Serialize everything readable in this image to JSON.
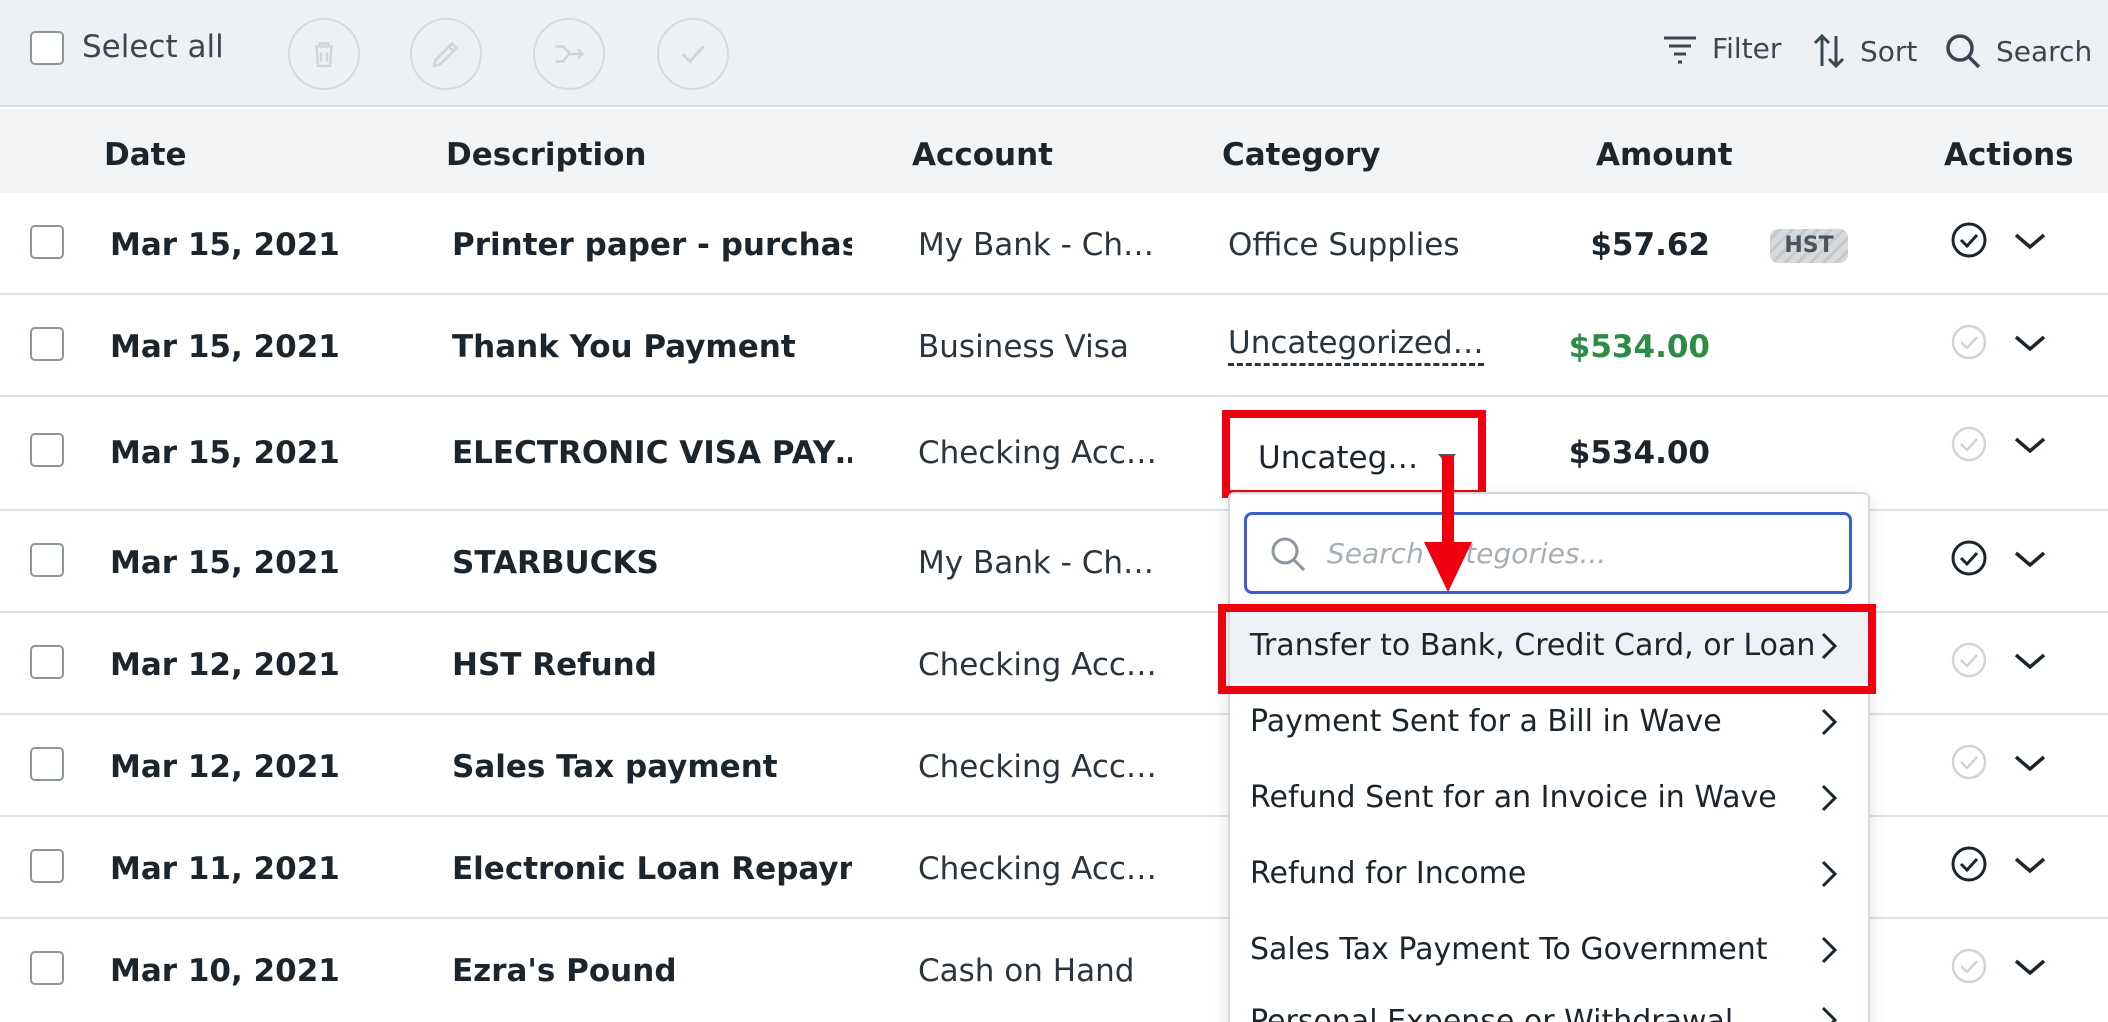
{
  "toolbar": {
    "select_all": "Select all",
    "filter": "Filter",
    "sort": "Sort",
    "search": "Search"
  },
  "columns": {
    "date": "Date",
    "description": "Description",
    "account": "Account",
    "category": "Category",
    "amount": "Amount",
    "actions": "Actions"
  },
  "rows": [
    {
      "date": "Mar 15, 2021",
      "description": "Printer paper - purchase…",
      "account": "My Bank - Ch…",
      "category": "Office Supplies",
      "amount": "$57.62",
      "tax_badge": "HST",
      "reviewed": true
    },
    {
      "date": "Mar 15, 2021",
      "description": "Thank You Payment",
      "account": "Business Visa",
      "category": "Uncategorized…",
      "amount": "$534.00",
      "reviewed": false
    },
    {
      "date": "Mar 15, 2021",
      "description": "ELECTRONIC VISA PAY…",
      "account": "Checking Acc…",
      "category": "Uncateg…",
      "amount": "$534.00",
      "reviewed": false
    },
    {
      "date": "Mar 15, 2021",
      "description": "STARBUCKS",
      "account": "My Bank - Ch…",
      "reviewed": true
    },
    {
      "date": "Mar 12, 2021",
      "description": "HST Refund",
      "account": "Checking Acc…",
      "reviewed": false
    },
    {
      "date": "Mar 12, 2021",
      "description": "Sales Tax payment",
      "account": "Checking Acc…",
      "reviewed": false
    },
    {
      "date": "Mar 11, 2021",
      "description": "Electronic Loan Repaym…",
      "account": "Checking Acc…",
      "reviewed": true
    },
    {
      "date": "Mar 10, 2021",
      "description": "Ezra's Pound",
      "account": "Cash on Hand",
      "reviewed": false
    }
  ],
  "dropdown": {
    "search_placeholder": "Search categories...",
    "items": [
      "Transfer to Bank, Credit Card, or Loan",
      "Payment Sent for a Bill in Wave",
      "Refund Sent for an Invoice in Wave",
      "Refund for Income",
      "Sales Tax Payment To Government",
      "Personal Expense or Withdrawal"
    ]
  },
  "colors": {
    "highlight": "#f0000f",
    "positive_amount": "#2e8b45",
    "focus_border": "#3c5fc8"
  }
}
